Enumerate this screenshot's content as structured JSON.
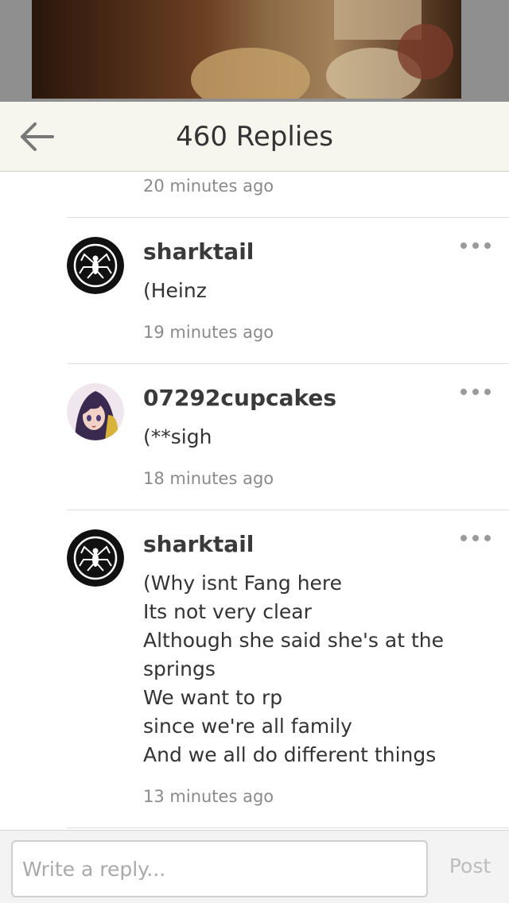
{
  "header": {
    "title": "460 Replies",
    "back_icon": "arrow-left-icon"
  },
  "feed": {
    "previous_timestamp": "20 minutes ago",
    "comments": [
      {
        "username": "sharktail",
        "avatar_icon": "spider-emblem-avatar",
        "text": "(Heinz",
        "timestamp": "19 minutes ago",
        "more_icon": "more-horizontal-icon"
      },
      {
        "username": "07292cupcakes",
        "avatar_icon": "anime-girl-avatar",
        "text": "(**sigh",
        "timestamp": "18 minutes ago",
        "more_icon": "more-horizontal-icon"
      },
      {
        "username": "sharktail",
        "avatar_icon": "spider-emblem-avatar",
        "text": "(Why isnt Fang here\nIts not very clear\nAlthough she said she's at the springs\nWe want to rp\nsince we're all family\nAnd we all do different things",
        "timestamp": "13 minutes ago",
        "more_icon": "more-horizontal-icon"
      }
    ]
  },
  "composer": {
    "placeholder": "Write a reply...",
    "value": "",
    "post_label": "Post"
  },
  "colors": {
    "header_bg": "#f6f5ee",
    "text_primary": "#333333",
    "text_muted": "#8a8a8a",
    "post_disabled": "#bdbdbd"
  }
}
